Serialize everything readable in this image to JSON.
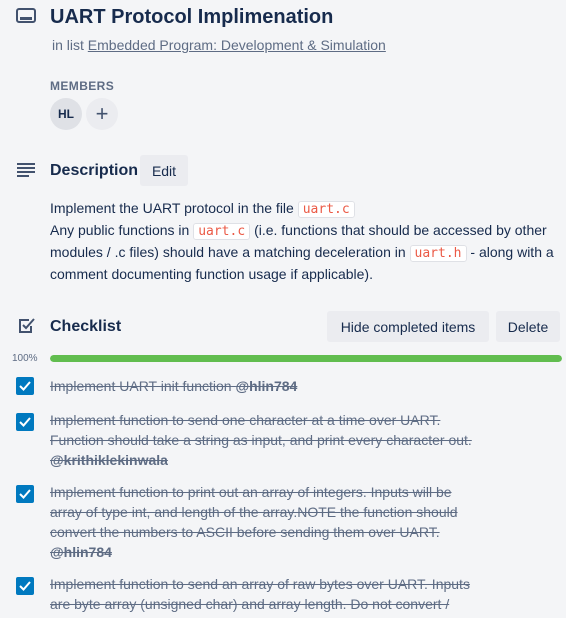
{
  "card": {
    "title": "UART Protocol Implimenation",
    "in_list_prefix": "in list",
    "list_name": "Embedded Program: Development & Simulation"
  },
  "members": {
    "label": "MEMBERS",
    "avatar_initials": "HL",
    "add_symbol": "+"
  },
  "description": {
    "heading": "Description",
    "edit_label": "Edit",
    "line1_text": "Implement the UART protocol in the file",
    "line1_code": "uart.c",
    "line2_text": "Any public functions in",
    "line2_code": "uart.c",
    "line2_rest": "(i.e. functions that should be accessed by other modules / .c files) should have a matching deceleration in",
    "line3_code": "uart.h",
    "line3_rest": "- along with a comment documenting function usage if applicable)."
  },
  "checklist": {
    "heading": "Checklist",
    "hide_label": "Hide completed items",
    "delete_label": "Delete",
    "progress_text": "100%",
    "progress_fraction": 1.0,
    "items": [
      {
        "text": "Implement UART init function",
        "mention": "@hlin784",
        "checked": true
      },
      {
        "text": "Implement function to send one character at a time over UART. Function should take a string as input, and print every character out.",
        "mention": "@krithiklekinwala",
        "checked": true
      },
      {
        "text": "Implement function to print out an array of integers. Inputs will be array of type int, and length of the array.NOTE the function should convert the numbers to ASCII before sending them over UART.",
        "mention": "@hlin784",
        "checked": true
      },
      {
        "text": "Implement function to send an array of raw bytes over UART. Inputs are byte array (unsigned char) and array length. Do not convert /",
        "mention": "",
        "checked": true
      }
    ]
  },
  "colors": {
    "accent": "#0079bf",
    "progress": "#61bd4f",
    "code": "#eb5a46"
  },
  "icons": {
    "card": "card-icon",
    "description": "description-icon",
    "checklist": "checklist-icon",
    "checkmark": "checkmark-icon"
  }
}
